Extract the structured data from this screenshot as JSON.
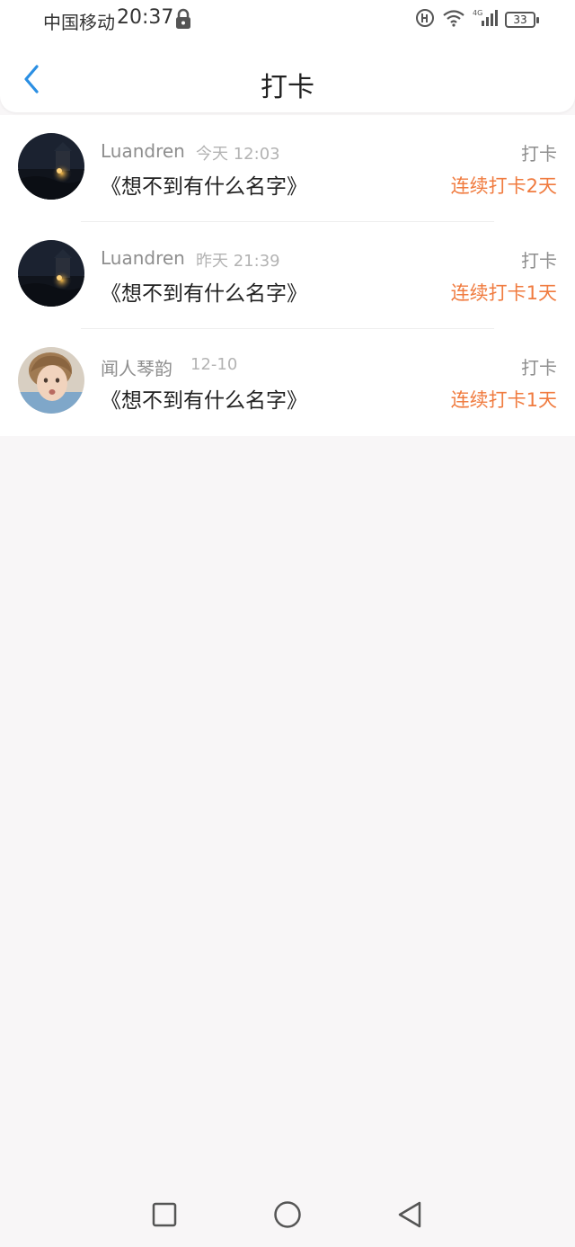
{
  "status_bar": {
    "carrier": "中国移动",
    "time": "20:37",
    "network": "4G",
    "battery": "33"
  },
  "header": {
    "title": "打卡"
  },
  "checkins": [
    {
      "username": "Luandren",
      "time": "今天 12:03",
      "book": "《想不到有什么名字》",
      "type": "打卡",
      "streak": "连续打卡2天",
      "avatar": "night-lantern-photo"
    },
    {
      "username": "Luandren",
      "time": "昨天 21:39",
      "book": "《想不到有什么名字》",
      "type": "打卡",
      "streak": "连续打卡1天",
      "avatar": "night-lantern-photo"
    },
    {
      "username": "闻人琴韵",
      "time": "12-10",
      "book": "《想不到有什么名字》",
      "type": "打卡",
      "streak": "连续打卡1天",
      "avatar": "child-portrait-photo"
    }
  ],
  "colors": {
    "accent": "#2b8fe3",
    "streak": "#f07b3f",
    "muted": "#8e8e8e"
  },
  "icons": {
    "back": "chevron-left-icon",
    "lock": "lock-icon",
    "nav_recent": "square-icon",
    "nav_home": "circle-icon",
    "nav_back": "triangle-back-icon"
  }
}
